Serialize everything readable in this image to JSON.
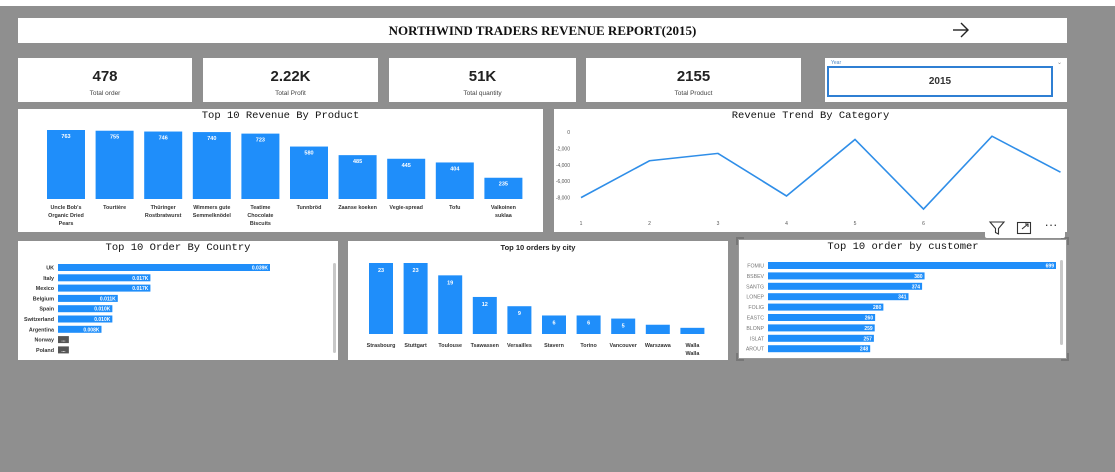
{
  "report": {
    "title": "NORTHWIND TRADERS REVENUE REPORT(2015)",
    "nav_icon": "arrow-right-icon"
  },
  "kpis": [
    {
      "value": "478",
      "label": "Total order"
    },
    {
      "value": "2.22K",
      "label": "Total Profit"
    },
    {
      "value": "51K",
      "label": "Total quantity"
    },
    {
      "value": "2155",
      "label": "Total Product"
    }
  ],
  "slicer": {
    "label": "Year",
    "value": "2015",
    "chevron": "chevron-down-icon"
  },
  "colors": {
    "bar": "#1f8efa",
    "line": "#2f8ee8",
    "background": "#8f8f8f"
  },
  "charts": {
    "product": {
      "title": "Top 10 Revenue By Product"
    },
    "trend": {
      "title": "Revenue Trend By Category"
    },
    "country": {
      "title": "Top 10 Order By Country"
    },
    "city": {
      "title": "Top 10 orders by city"
    },
    "customer": {
      "title": "Top 10 order by customer"
    }
  },
  "toolbar": {
    "icons": [
      "filter-icon",
      "focus-mode-icon",
      "more-options-icon"
    ],
    "more_label": "···"
  },
  "chart_data": [
    {
      "type": "bar",
      "title": "Top 10 Revenue By Product",
      "categories": [
        [
          "Uncle Bob's",
          "Organic Dried",
          "Pears"
        ],
        [
          "Tourtière"
        ],
        [
          "Thüringer",
          "Rostbratwurst"
        ],
        [
          "Wimmers gute",
          "Semmelknödel"
        ],
        [
          "Teatime",
          "Chocolate",
          "Biscuits"
        ],
        [
          "Tunnbröd"
        ],
        [
          "Zaanse koeken"
        ],
        [
          "Vegie-spread"
        ],
        [
          "Tofu"
        ],
        [
          "Valkoinen",
          "suklaa"
        ]
      ],
      "values": [
        763,
        755,
        746,
        740,
        723,
        580,
        485,
        445,
        404,
        235
      ],
      "labels": [
        "763",
        "755",
        "746",
        "740",
        "723",
        "580",
        "485",
        "445",
        "404",
        "235"
      ]
    },
    {
      "type": "line",
      "title": "Revenue Trend By Category",
      "x": [
        1,
        2,
        3,
        4,
        5,
        6,
        7,
        8
      ],
      "x_ticks": [
        "1",
        "2",
        "3",
        "4",
        "5",
        "6"
      ],
      "y_ticks": [
        "0",
        "-2,000",
        "-4,000",
        "-6,000",
        "-8,000"
      ],
      "y_tick_values": [
        0,
        -2000,
        -4000,
        -6000,
        -8000
      ],
      "values": [
        -8000,
        -3500,
        -2600,
        -7800,
        -900,
        -9400,
        -500,
        -4900
      ],
      "ylim": [
        -10000,
        500
      ]
    },
    {
      "type": "bar",
      "orientation": "horizontal",
      "title": "Top 10 Order By Country",
      "categories": [
        "UK",
        "Italy",
        "Mexico",
        "Belgium",
        "Spain",
        "Switzerland",
        "Argentina",
        "Norway",
        "Poland"
      ],
      "values": [
        0.039,
        0.017,
        0.017,
        0.011,
        0.01,
        0.01,
        0.008,
        0.002,
        0.002
      ],
      "labels": [
        "0.039K",
        "0.017K",
        "0.017K",
        "0.011K",
        "0.010K",
        "0.010K",
        "0.008K",
        "...",
        "..."
      ]
    },
    {
      "type": "bar",
      "title": "Top 10 orders by city",
      "categories": [
        [
          "Strasbourg"
        ],
        [
          "Stuttgart"
        ],
        [
          "Toulouse"
        ],
        [
          "Tsawassen"
        ],
        [
          "Versailles"
        ],
        [
          "Stavern"
        ],
        [
          "Torino"
        ],
        [
          "Vancouver"
        ],
        [
          "Warszawa"
        ],
        [
          "Walla",
          "Walla"
        ]
      ],
      "values": [
        23,
        23,
        19,
        12,
        9,
        6,
        6,
        5,
        3,
        2
      ],
      "labels": [
        "23",
        "23",
        "19",
        "12",
        "9",
        "6",
        "6",
        "5",
        "",
        ""
      ]
    },
    {
      "type": "bar",
      "orientation": "horizontal",
      "title": "Top 10 order by customer",
      "categories": [
        "FOMIU",
        "BSBEV",
        "SANTG",
        "LONEP",
        "FOLIG",
        "EASTC",
        "BLONP",
        "ISLAT",
        "AROUT"
      ],
      "values": [
        699,
        380,
        374,
        341,
        280,
        260,
        259,
        257,
        248
      ],
      "labels": [
        "699",
        "380",
        "374",
        "341",
        "280",
        "260",
        "259",
        "257",
        "248"
      ]
    }
  ]
}
